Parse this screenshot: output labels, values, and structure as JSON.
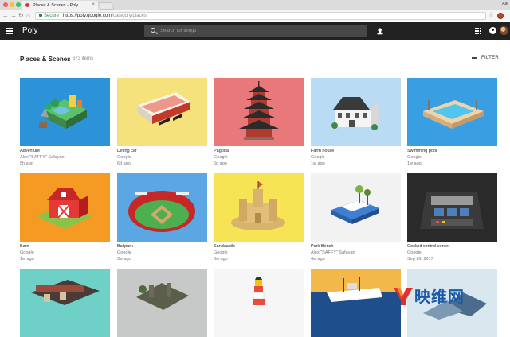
{
  "browser": {
    "tab_title": "Places & Scenes - Poly",
    "tab_close": "×",
    "user_name": "Ale",
    "nav": {
      "back": "←",
      "forward": "→",
      "reload": "↻",
      "home": "⌂"
    },
    "address": {
      "secure_label": "Secure",
      "separator": " | ",
      "host": "https://poly.google.com",
      "path": "/category/places"
    },
    "bookmark_star": "☆",
    "traffic_colors": [
      "#fc605c",
      "#fdbc40",
      "#34c84a"
    ]
  },
  "appbar": {
    "brand": "Poly",
    "search_placeholder": "Search for things",
    "icons": [
      "menu-icon",
      "search-icon",
      "upload-icon",
      "apps-grid-icon",
      "account-icon"
    ]
  },
  "header": {
    "title": "Places & Scenes",
    "count": "673 items",
    "filter_label": "FILTER"
  },
  "items": [
    {
      "title": "Adventure",
      "author": "Alex \"SAFFY\" Safayan",
      "date": "5h ago",
      "bg": "#2c93d8"
    },
    {
      "title": "Dining car",
      "author": "Google",
      "date": "6d ago",
      "bg": "#f5e27c"
    },
    {
      "title": "Pagoda",
      "author": "Google",
      "date": "6d ago",
      "bg": "#e9787a"
    },
    {
      "title": "Farm house",
      "author": "Google",
      "date": "1w ago",
      "bg": "#b9dcf4"
    },
    {
      "title": "Swimming pool",
      "author": "Google",
      "date": "1w ago",
      "bg": "#3a9fe2"
    },
    {
      "title": "Barn",
      "author": "Google",
      "date": "1w ago",
      "bg": "#f59b23"
    },
    {
      "title": "Ballpark",
      "author": "Google",
      "date": "3w ago",
      "bg": "#5aa7e4"
    },
    {
      "title": "Sandcastle",
      "author": "Google",
      "date": "3w ago",
      "bg": "#f6e455"
    },
    {
      "title": "Park Bench",
      "author": "Alex \"SAFFY\" Safayan",
      "date": "4w ago",
      "bg": "#f2f2f2"
    },
    {
      "title": "Cockpit control center",
      "author": "Google",
      "date": "Sep 26, 2017",
      "bg": "#2a2a2a"
    },
    {
      "title": "",
      "author": "",
      "date": "",
      "bg": "#6fd0c8"
    },
    {
      "title": "",
      "author": "",
      "date": "",
      "bg": "#c7c9c8"
    },
    {
      "title": "",
      "author": "",
      "date": "",
      "bg": "#f6f6f6"
    },
    {
      "title": "",
      "author": "",
      "date": "",
      "bg": "#f3b84a"
    },
    {
      "title": "",
      "author": "",
      "date": "",
      "bg": "#d9e7ee"
    }
  ],
  "watermark": {
    "text": "映维网"
  }
}
